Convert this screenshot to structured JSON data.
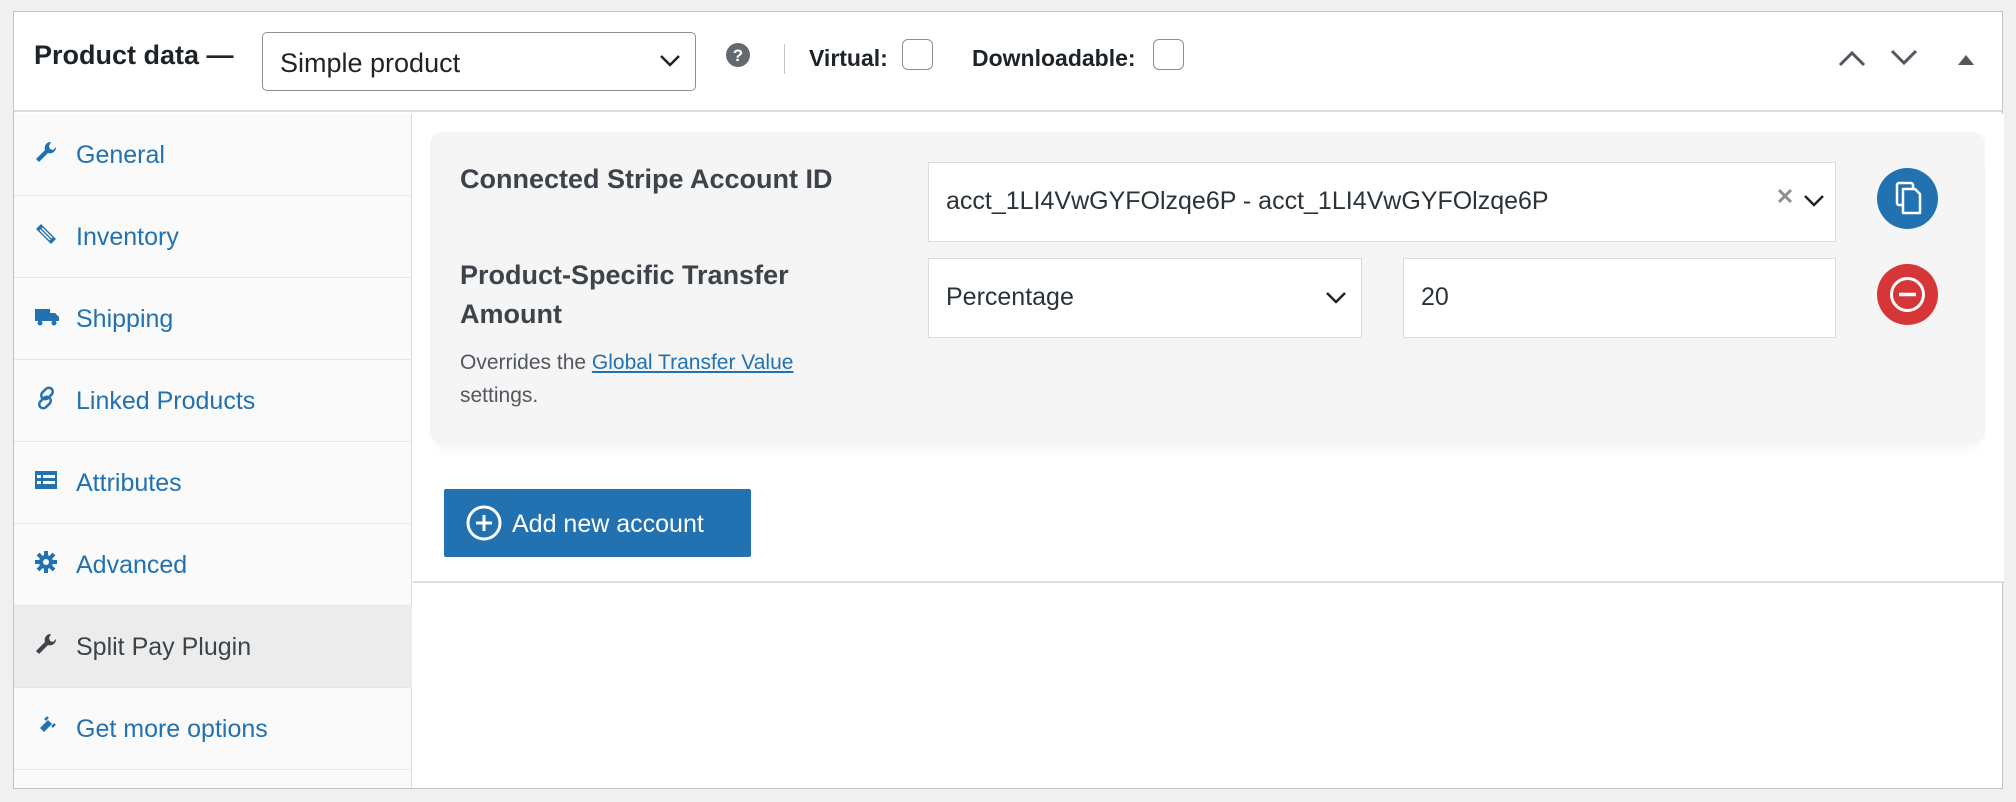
{
  "header": {
    "title": "Product data —",
    "product_type": "Simple product",
    "virtual_label": "Virtual:",
    "downloadable_label": "Downloadable:",
    "virtual_checked": false,
    "downloadable_checked": false
  },
  "tabs": [
    {
      "label": "General",
      "icon": "wrench-icon"
    },
    {
      "label": "Inventory",
      "icon": "tag-icon"
    },
    {
      "label": "Shipping",
      "icon": "truck-icon"
    },
    {
      "label": "Linked Products",
      "icon": "link-icon"
    },
    {
      "label": "Attributes",
      "icon": "list-icon"
    },
    {
      "label": "Advanced",
      "icon": "gear-icon"
    },
    {
      "label": "Split Pay Plugin",
      "icon": "wrench-icon",
      "active": true
    },
    {
      "label": "Get more options",
      "icon": "plugin-icon"
    }
  ],
  "account": {
    "account_id_label": "Connected Stripe Account ID",
    "account_id_value": "acct_1LI4VwGYFOlzqe6P - acct_1LI4VwGYFOlzqe6P",
    "transfer_label_line1": "Product-Specific Transfer",
    "transfer_label_line2": "Amount",
    "desc_prefix": "Overrides the ",
    "desc_link": "Global Transfer Value",
    "desc_suffix": "settings.",
    "transfer_type": "Percentage",
    "transfer_value": "20"
  },
  "add_button_label": "Add new account",
  "colors": {
    "link": "#2271b1",
    "primary_button": "#2271b1",
    "remove_button": "#d63638"
  }
}
